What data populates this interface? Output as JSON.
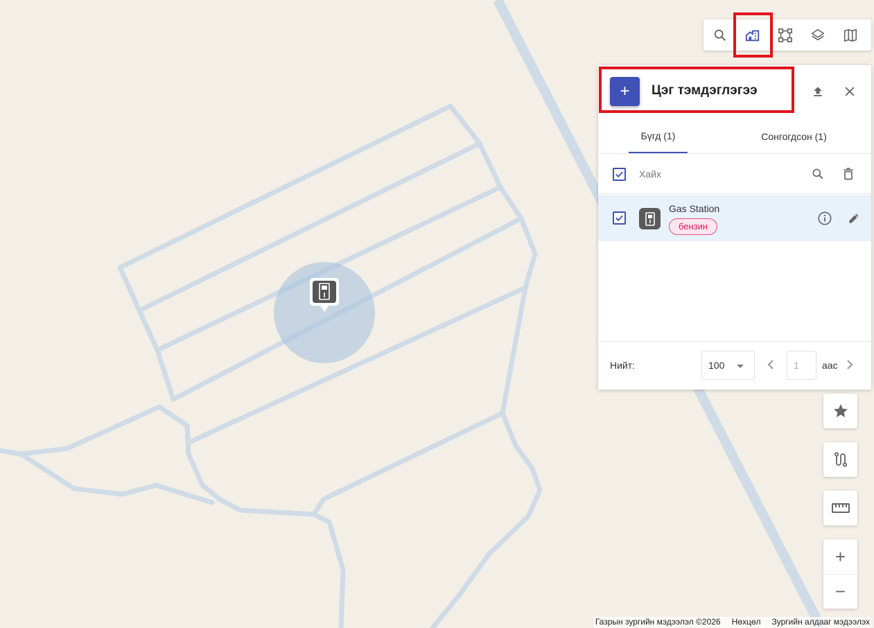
{
  "toolbar": {
    "items": [
      {
        "name": "search-icon"
      },
      {
        "name": "building-icon"
      },
      {
        "name": "polygon-icon"
      },
      {
        "name": "layers-icon"
      },
      {
        "name": "map-icon"
      }
    ]
  },
  "panel": {
    "title": "Цэг тэмдэглэгээ",
    "add_label": "+",
    "tabs": [
      {
        "label": "Бүгд (1)",
        "active": true
      },
      {
        "label": "Сонгогдсон (1)",
        "active": false
      }
    ],
    "search": {
      "placeholder": "Хайх"
    },
    "items": [
      {
        "name": "Gas Station",
        "tag": "бензин",
        "checked": true
      }
    ],
    "footer": {
      "total_label": "Нийт:",
      "page_size": "100",
      "page_placeholder": "1",
      "page_suffix": "аас"
    }
  },
  "controls": {
    "zoom_in": "+",
    "zoom_out": "−"
  },
  "attribution": {
    "copyright": "Газрын зургийн мэдээлэл ©2026",
    "terms": "Нөхцөл",
    "report": "Зургийн алдааг мэдээлэх"
  },
  "colors": {
    "accent": "#3f51b5",
    "highlight": "#e0141e",
    "map_bg": "#f3efe6",
    "road": "#cfdbe6",
    "tag": "#d81b60"
  }
}
